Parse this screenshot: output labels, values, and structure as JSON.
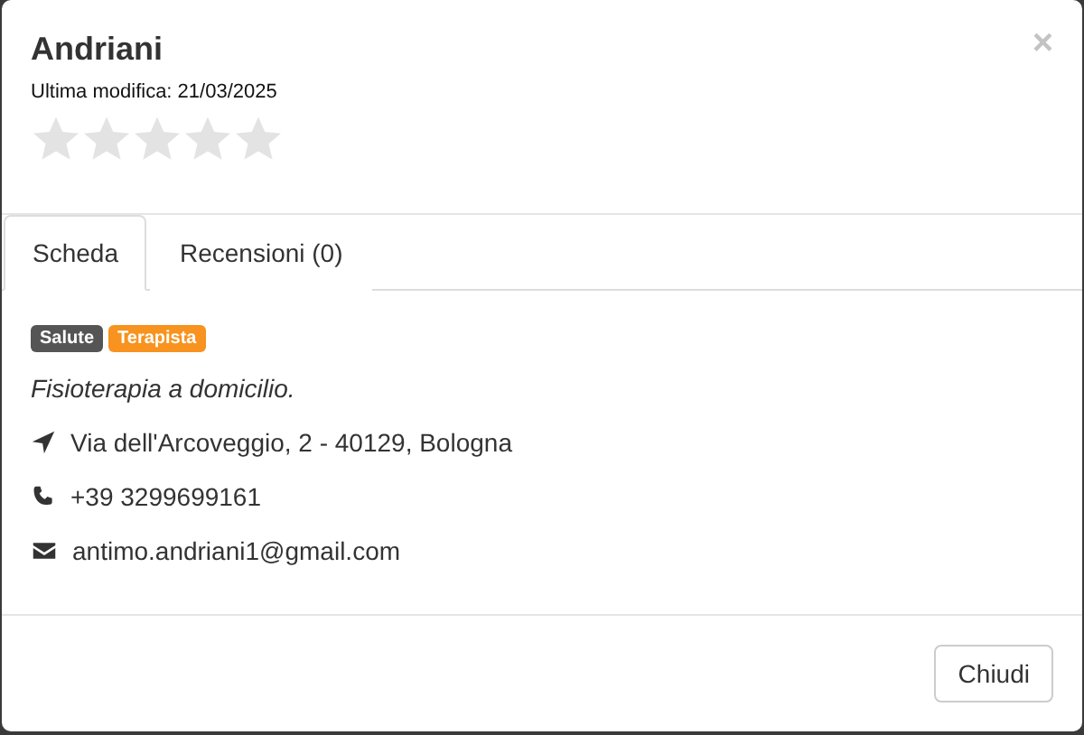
{
  "modal": {
    "title": "Andriani",
    "close": "×",
    "subtitle": "Ultima modifica: 21/03/2025",
    "stars": 0
  },
  "tabs": [
    {
      "label": "Scheda",
      "selected": true
    },
    {
      "label": "Recensioni (0)",
      "selected": false
    }
  ],
  "tags": [
    {
      "label": "Salute",
      "color": "#555555"
    },
    {
      "label": "Terapista",
      "color": "#f7931e"
    }
  ],
  "description": "Fisioterapia a domicilio.",
  "contacts": [
    {
      "kind": "address",
      "text": "Via dell'Arcoveggio, 2 - 40129, Bologna"
    },
    {
      "kind": "phone",
      "text": "+39 3299699161"
    },
    {
      "kind": "email",
      "text": "antimo.andriani1@gmail.com"
    }
  ],
  "footer": {
    "button": "Chiudi"
  }
}
